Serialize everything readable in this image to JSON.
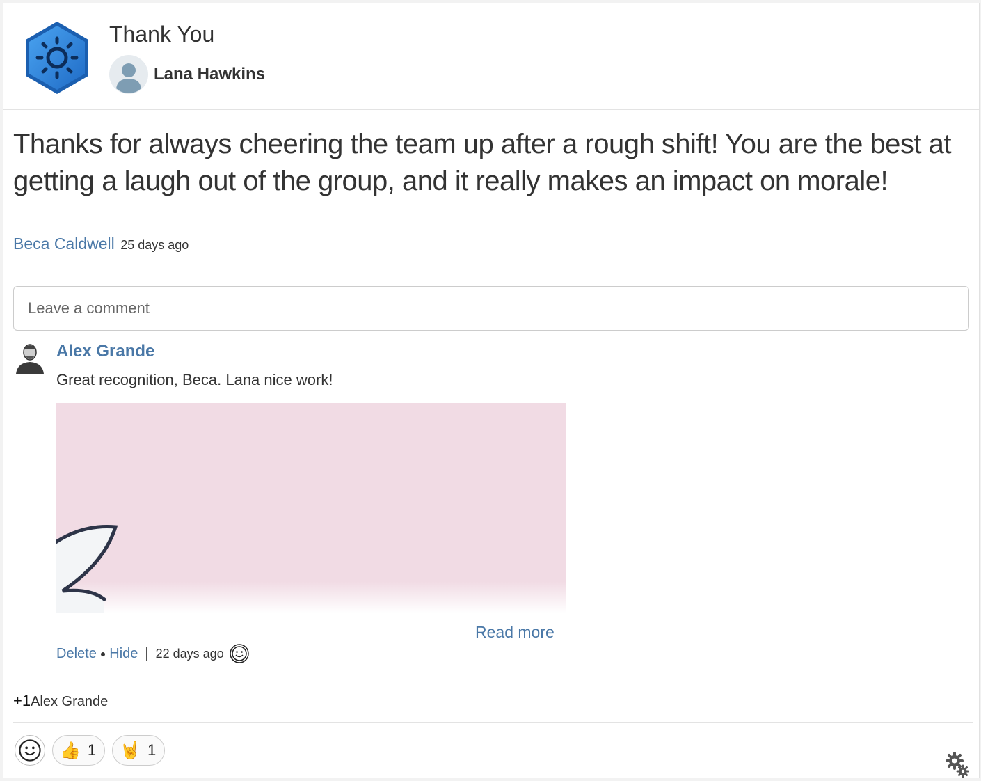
{
  "header": {
    "title": "Thank You",
    "recipient": "Lana Hawkins",
    "badge_icon": "sun-hexagon-badge-icon",
    "accent_color": "#2f7fd8"
  },
  "post": {
    "message": "Thanks for always cheering the team up after a rough shift! You are the best at getting a laugh out of the group, and it really makes an impact on morale!",
    "author": "Beca Caldwell",
    "time": "25 days ago"
  },
  "comment_box": {
    "placeholder": "Leave a comment"
  },
  "comment": {
    "author": "Alex Grande",
    "text": "Great recognition, Beca. Lana nice work!",
    "read_more": "Read more",
    "delete": "Delete",
    "hide": "Hide",
    "separator": "|",
    "time": "22 days ago",
    "image_bg": "#f1dbe4"
  },
  "plus_one": {
    "count": "+1",
    "name": "Alex Grande"
  },
  "reactions": [
    {
      "icon": "thumbs-up-emoji",
      "emoji": "👍",
      "count": "1"
    },
    {
      "icon": "rock-on-emoji",
      "emoji": "🤘",
      "count": "1"
    }
  ],
  "colors": {
    "link": "#4a78a7",
    "text": "#333333"
  }
}
